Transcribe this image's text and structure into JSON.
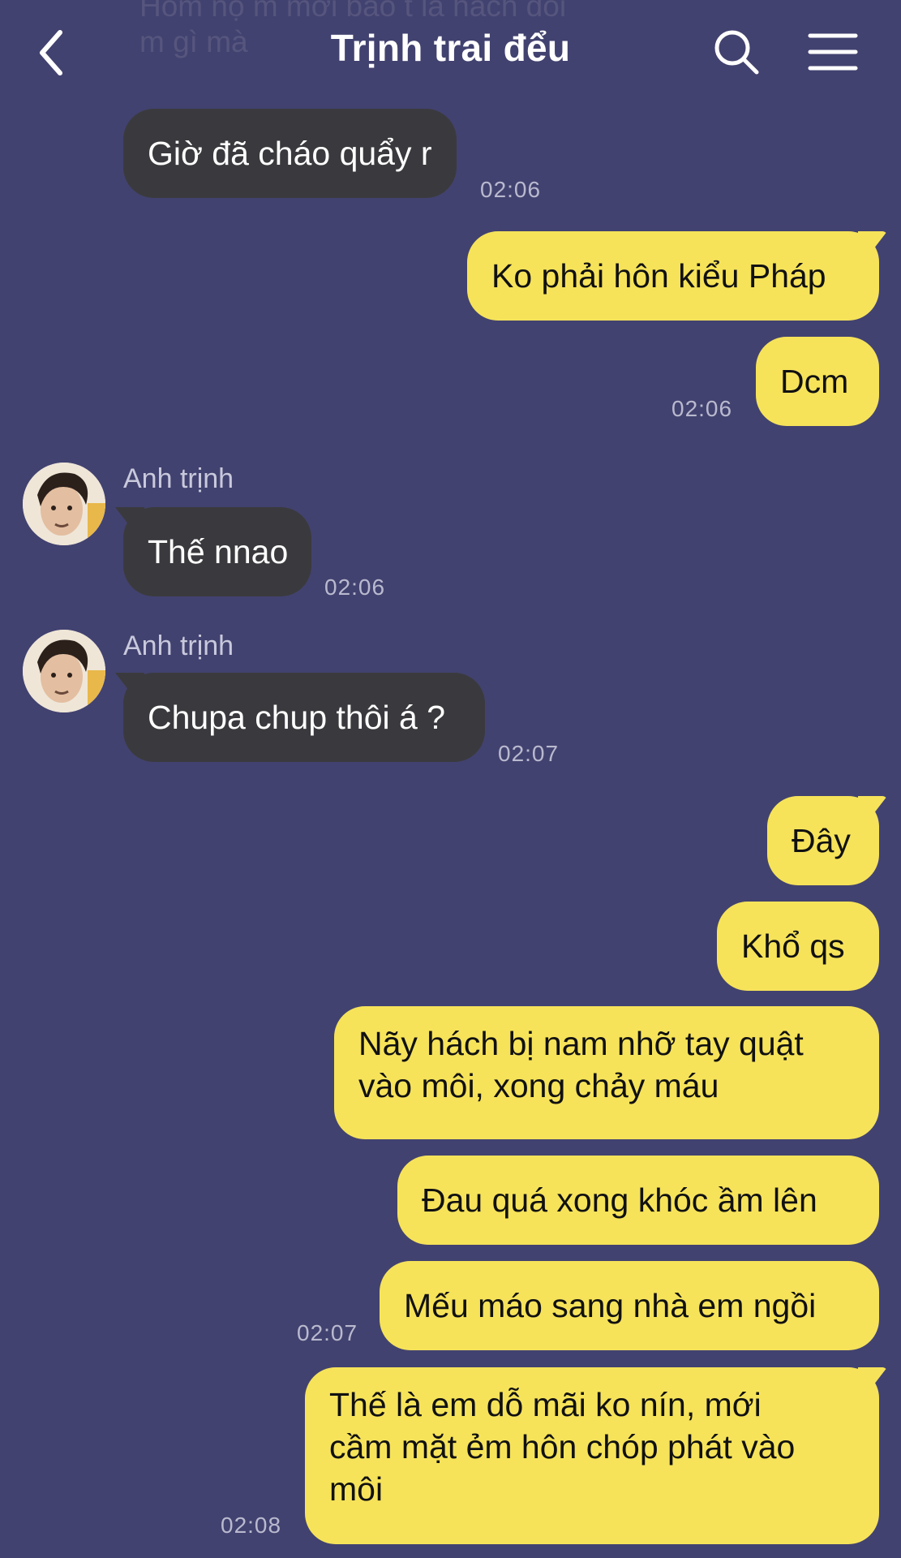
{
  "header": {
    "title": "Trịnh trai đểu",
    "back_icon": "chevron-left-icon",
    "search_icon": "search-icon",
    "menu_icon": "hamburger-menu-icon"
  },
  "faded_message": {
    "line1": "Hôm nọ m mới bảo t là hách đòi",
    "line2": "m gì mà"
  },
  "sender": {
    "name": "Anh trịnh",
    "avatar": "avatar-photo"
  },
  "messages": [
    {
      "text": "Giờ đã cháo quẩy r",
      "time": "02:06"
    },
    {
      "text": "Ko phải hôn kiểu Pháp"
    },
    {
      "text": "Dcm",
      "time": "02:06"
    },
    {
      "text": "Thế nnao",
      "time": "02:06"
    },
    {
      "text": "Chupa chup thôi á ?",
      "time": "02:07"
    },
    {
      "text": "Đây"
    },
    {
      "text": "Khổ qs"
    },
    {
      "lines": [
        "Nãy hách bị nam nhỡ tay quật",
        "vào môi, xong chảy máu"
      ]
    },
    {
      "text": "Đau quá xong khóc ầm lên"
    },
    {
      "text": "Mếu máo sang nhà em ngồi",
      "time": "02:07"
    },
    {
      "lines": [
        "Thế là em dỗ mãi ko nín, mới",
        "cầm mặt ẻm hôn chóp phát vào",
        "môi"
      ],
      "time": "02:08"
    }
  ],
  "colors": {
    "background": "#424270",
    "incoming_bubble": "#3a3a3e",
    "outgoing_bubble": "#f6e35a"
  }
}
